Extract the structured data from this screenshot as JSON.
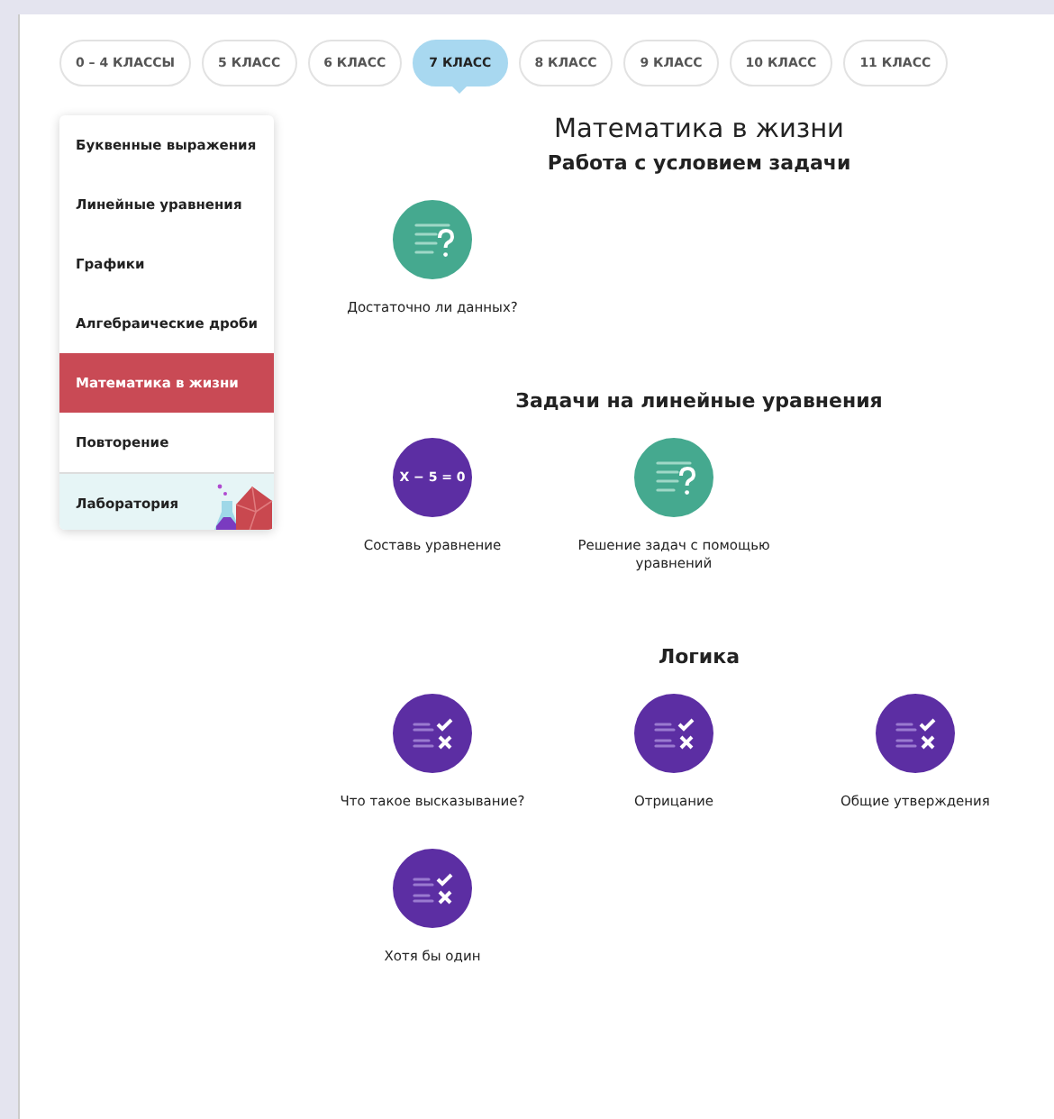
{
  "grades": [
    {
      "label": "0 – 4 КЛАССЫ",
      "selected": false
    },
    {
      "label": "5 КЛАСС",
      "selected": false
    },
    {
      "label": "6 КЛАСС",
      "selected": false
    },
    {
      "label": "7 КЛАСС",
      "selected": true
    },
    {
      "label": "8 КЛАСС",
      "selected": false
    },
    {
      "label": "9 КЛАСС",
      "selected": false
    },
    {
      "label": "10 КЛАСС",
      "selected": false
    },
    {
      "label": "11 КЛАСС",
      "selected": false
    }
  ],
  "sidebar": {
    "items": [
      {
        "label": "Буквенные выражения",
        "selected": false,
        "kind": "topic"
      },
      {
        "label": "Линейные уравнения",
        "selected": false,
        "kind": "topic"
      },
      {
        "label": "Графики",
        "selected": false,
        "kind": "topic"
      },
      {
        "label": "Алгебраические дроби",
        "selected": false,
        "kind": "topic"
      },
      {
        "label": "Математика в жизни",
        "selected": true,
        "kind": "topic"
      },
      {
        "label": "Повторение",
        "selected": false,
        "kind": "topic"
      },
      {
        "label": "Лаборатория",
        "selected": false,
        "kind": "lab"
      }
    ]
  },
  "page_title": "Математика в жизни",
  "sections": [
    {
      "title": "Работа с условием задачи",
      "items": [
        {
          "kind": "question",
          "label": "Достаточно ли данных?"
        }
      ]
    },
    {
      "title": "Задачи на линейные уравнения",
      "items": [
        {
          "kind": "equation",
          "icon_text": "X − 5 = 0",
          "label": "Составь уравнение"
        },
        {
          "kind": "question",
          "label": "Решение задач с помощью уравнений"
        }
      ]
    },
    {
      "title": "Логика",
      "items": [
        {
          "kind": "logic",
          "label": "Что такое высказывание?"
        },
        {
          "kind": "logic",
          "label": "Отрицание"
        },
        {
          "kind": "logic",
          "label": "Общие утверждения"
        },
        {
          "kind": "logic",
          "label": "Хотя бы один"
        }
      ]
    }
  ]
}
